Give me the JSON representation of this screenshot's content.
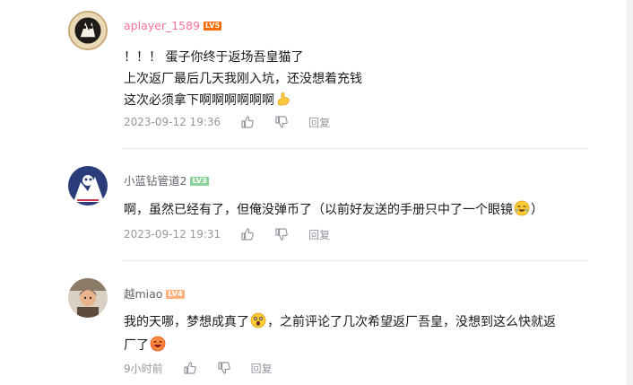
{
  "comments": [
    {
      "username": "aplayer_1589",
      "username_color": "#fb7299",
      "level": "LV5",
      "level_color": "#ff6c00",
      "lines": [
        "！！！ 蛋子你终于返场吾皇猫了",
        "上次返厂最后几天我刚入坑，还没想着充钱",
        "这次必须拿下啊啊啊啊啊啊"
      ],
      "time": "2023-09-12 19:36",
      "reply_label": "回复"
    },
    {
      "username": "小蓝钻管道2",
      "username_color": "#61666d",
      "level": "LV3",
      "level_color": "#8bd29b",
      "lines": [
        "啊，虽然已经有了，但俺没弹币了（以前好友送的手册只中了一个眼镜",
        "）"
      ],
      "time": "2023-09-12 19:31",
      "reply_label": "回复"
    },
    {
      "username": "越miao",
      "username_color": "#61666d",
      "level": "LV4",
      "level_color": "#ffb27f",
      "lines": [
        "我的天哪，梦想成真了",
        "，之前评论了几次希望返厂吾皇，没想到这么快就返",
        "厂了"
      ],
      "time": "9小时前",
      "reply_label": "回复"
    }
  ],
  "icons": {
    "like": "thumb-up-icon",
    "dislike": "thumb-down-icon",
    "emoji_flex": "flexed-biceps-emoji",
    "emoji_tears": "tears-of-joy-emoji",
    "emoji_shock": "shocked-face-emoji",
    "emoji_happy": "happy-face-emoji"
  }
}
